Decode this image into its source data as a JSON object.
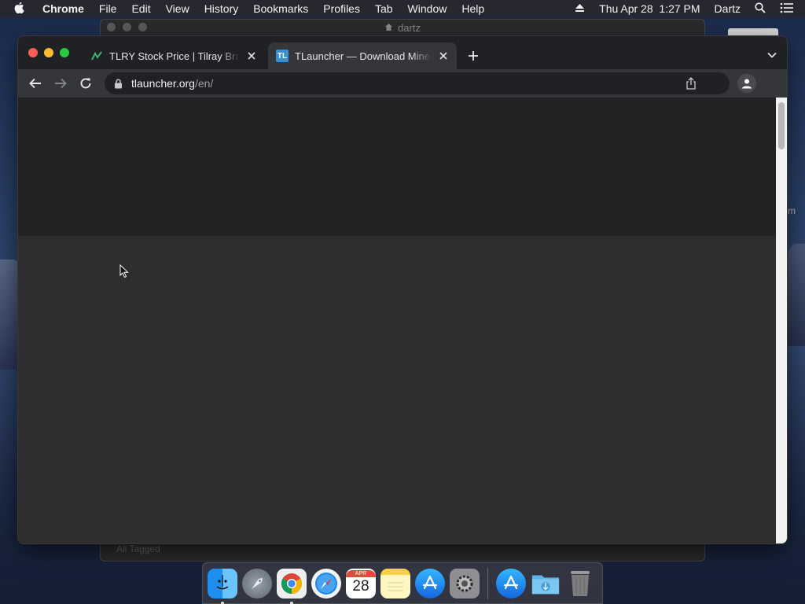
{
  "menubar": {
    "app_name": "Chrome",
    "menus": [
      "File",
      "Edit",
      "View",
      "History",
      "Bookmarks",
      "Profiles",
      "Tab",
      "Window",
      "Help"
    ],
    "datetime": "Thu Apr 28  1:27 PM",
    "user": "Dartz"
  },
  "background_window": {
    "title": "dartz",
    "footer_text": "All Tagged"
  },
  "desktop": {
    "side_label": "m"
  },
  "browser": {
    "tabs": [
      {
        "title": "TLRY Stock Price | Tilray Brands",
        "favicon": "chart-icon",
        "active": false
      },
      {
        "title": "TLauncher — Download Minecraft",
        "favicon": "tlauncher-icon",
        "favicon_text": "TL",
        "active": true
      }
    ],
    "url": {
      "host": "tlauncher.org",
      "path": "/en/"
    }
  },
  "dock": {
    "calendar_month": "APR",
    "calendar_day": "28",
    "apps": [
      "finder",
      "launchpad",
      "chrome",
      "safari",
      "calendar",
      "notes",
      "app-store",
      "system-preferences",
      "app-store-2",
      "downloads-folder",
      "trash"
    ]
  },
  "colors": {
    "close": "#fe5f57",
    "minimize": "#febc2e",
    "zoom": "#28c840",
    "toolbar": "#35363a",
    "tabstrip": "#202124"
  }
}
